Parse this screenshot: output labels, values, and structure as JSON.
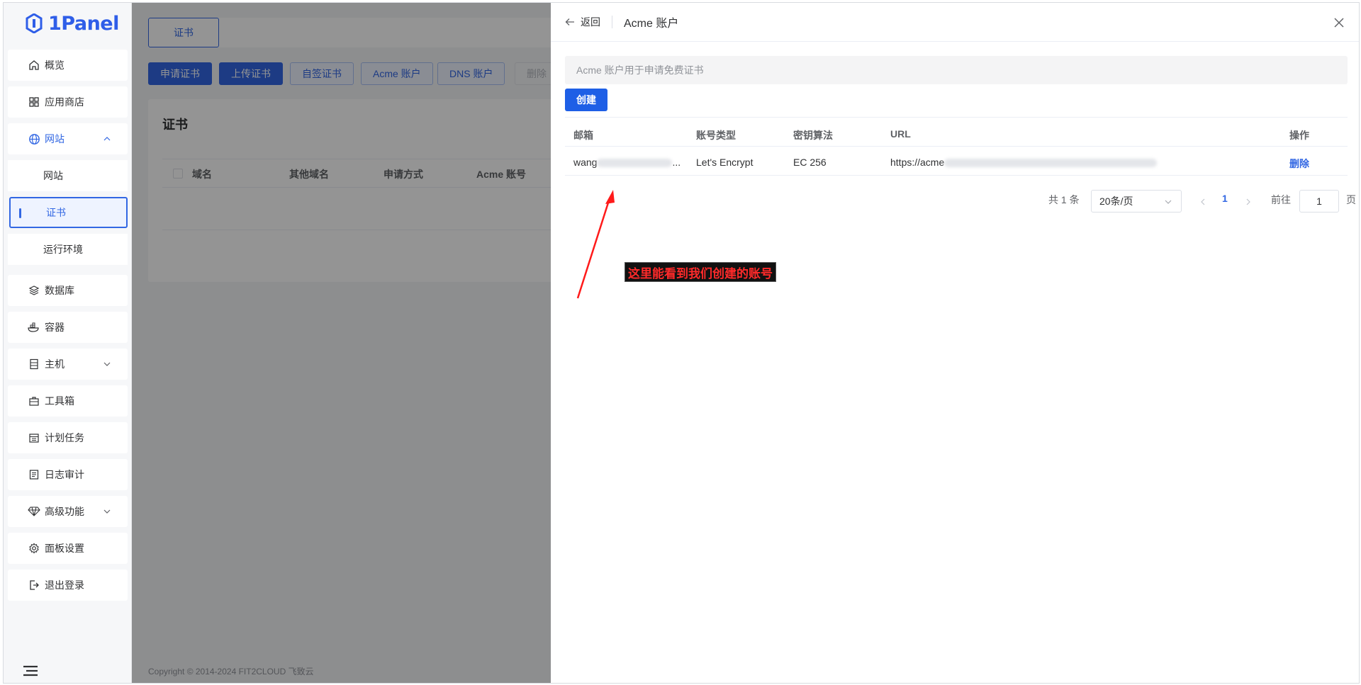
{
  "app": {
    "logo_text": "1Panel"
  },
  "sidebar": {
    "items": [
      {
        "label": "概览",
        "icon": "home-icon"
      },
      {
        "label": "应用商店",
        "icon": "grid-icon"
      },
      {
        "label": "网站",
        "icon": "globe-icon",
        "expanded": true
      },
      {
        "label": "网站",
        "sub": true
      },
      {
        "label": "证书",
        "sub": true,
        "active": true
      },
      {
        "label": "运行环境",
        "sub": true
      },
      {
        "label": "数据库",
        "icon": "layers-icon"
      },
      {
        "label": "容器",
        "icon": "docker-icon"
      },
      {
        "label": "主机",
        "icon": "server-icon",
        "has_chevron": true
      },
      {
        "label": "工具箱",
        "icon": "toolbox-icon"
      },
      {
        "label": "计划任务",
        "icon": "calendar-icon"
      },
      {
        "label": "日志审计",
        "icon": "log-icon"
      },
      {
        "label": "高级功能",
        "icon": "diamond-icon",
        "has_chevron": true
      },
      {
        "label": "面板设置",
        "icon": "gear-icon"
      },
      {
        "label": "退出登录",
        "icon": "logout-icon"
      }
    ]
  },
  "main": {
    "tab": "证书",
    "toolbar": {
      "apply_cert": "申请证书",
      "upload_cert": "上传证书",
      "self_signed": "自签证书",
      "acme_account": "Acme 账户",
      "dns_account": "DNS 账户",
      "delete": "删除"
    },
    "card": {
      "title": "证书",
      "columns": [
        "域名",
        "其他域名",
        "申请方式",
        "Acme 账号"
      ]
    },
    "footer": "Copyright © 2014-2024 FIT2CLOUD 飞致云"
  },
  "drawer": {
    "back_label": "返回",
    "title": "Acme 账户",
    "hint": "Acme 账户用于申请免费证书",
    "create_label": "创建",
    "columns": [
      "邮箱",
      "账号类型",
      "密钥算法",
      "URL",
      "操作"
    ],
    "rows": [
      {
        "email": "wang",
        "email_tail": "...",
        "type": "Let's Encrypt",
        "algo": "EC 256",
        "url": "https://acme",
        "action": "删除"
      }
    ],
    "pagination": {
      "total": "共 1 条",
      "page_size": "20条/页",
      "current_page": "1",
      "goto_label": "前往",
      "goto_value": "1",
      "page_suffix": "页"
    },
    "annotation": "这里能看到我们创建的账号"
  },
  "colors": {
    "accent": "#3267e3",
    "annotation_text": "#ff2a2a",
    "arrow": "#ff1a1a"
  }
}
